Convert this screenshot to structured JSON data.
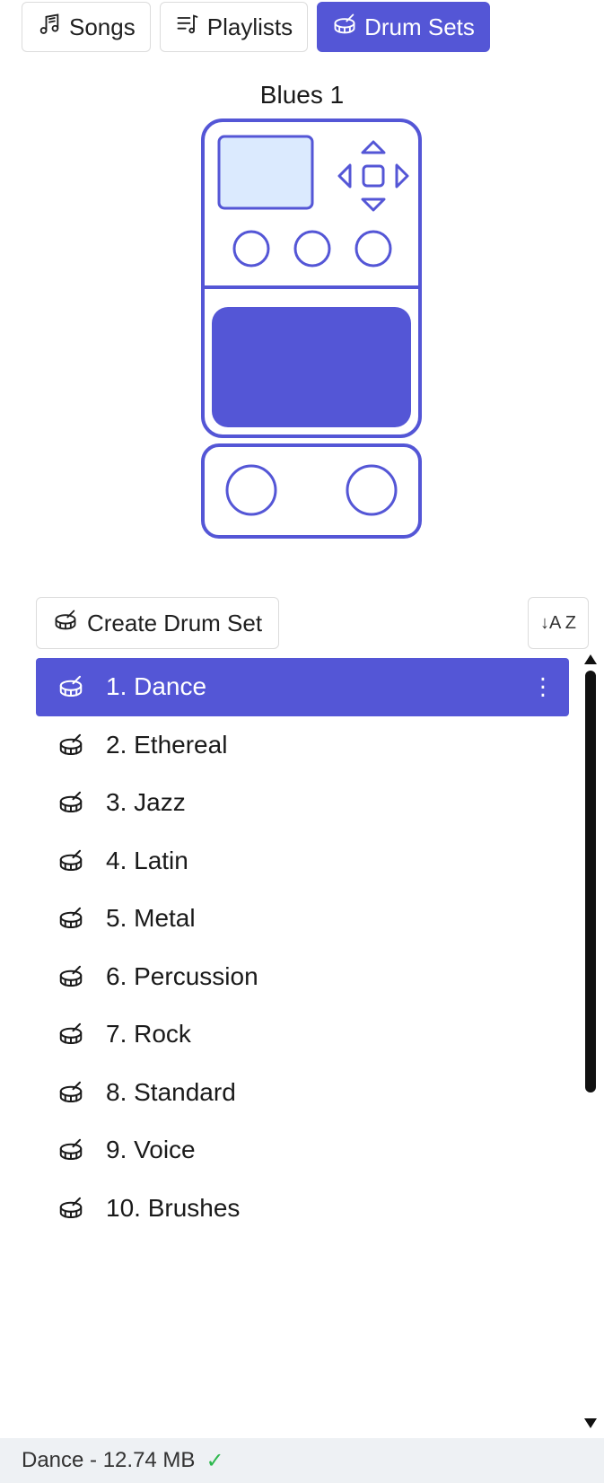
{
  "tabs": [
    {
      "label": "Songs",
      "icon": "music-note-icon",
      "active": false
    },
    {
      "label": "Playlists",
      "icon": "playlist-icon",
      "active": false
    },
    {
      "label": "Drum Sets",
      "icon": "drum-icon",
      "active": true
    }
  ],
  "device": {
    "title": "Blues 1"
  },
  "toolbar": {
    "create_label": "Create Drum Set",
    "sort_label": "↓A Z"
  },
  "drum_sets": [
    {
      "label": "1. Dance",
      "selected": true
    },
    {
      "label": "2. Ethereal",
      "selected": false
    },
    {
      "label": "3. Jazz",
      "selected": false
    },
    {
      "label": "4. Latin",
      "selected": false
    },
    {
      "label": "5. Metal",
      "selected": false
    },
    {
      "label": "6. Percussion",
      "selected": false
    },
    {
      "label": "7. Rock",
      "selected": false
    },
    {
      "label": "8. Standard",
      "selected": false
    },
    {
      "label": "9. Voice",
      "selected": false
    },
    {
      "label": "10. Brushes",
      "selected": false
    }
  ],
  "row_menu_glyph": "⋮",
  "status": {
    "text": "Dance - 12.74 MB",
    "check": "✓"
  },
  "colors": {
    "accent": "#5456d6",
    "accent_light": "#dbeafe",
    "status_bg": "#eef1f4",
    "check_green": "#2db84d"
  }
}
